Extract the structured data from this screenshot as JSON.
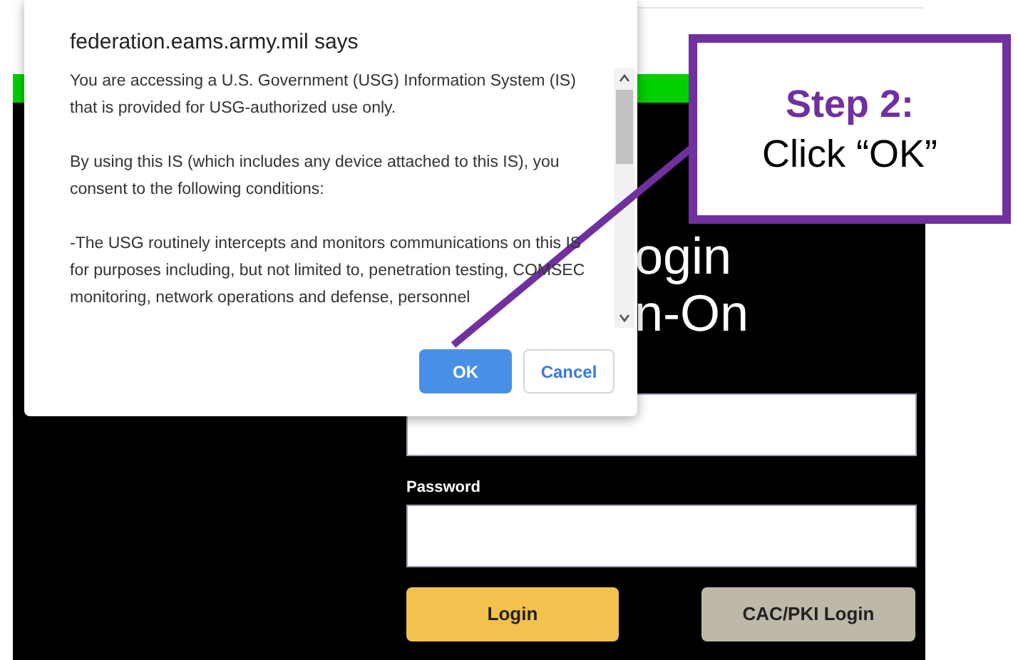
{
  "dialog": {
    "title": "federation.eams.army.mil says",
    "paragraphs": [
      "You are accessing a U.S. Government (USG) Information System (IS) that is provided for USG-authorized use only.",
      "By using this IS (which includes any device attached to this IS), you consent to the following conditions:",
      "-The USG routinely intercepts and monitors communications on this IS for purposes including, but not limited to, penetration testing, COMSEC monitoring, network operations and defense, personnel"
    ],
    "buttons": [
      {
        "label": "OK",
        "kind": "primary"
      },
      {
        "label": "Cancel",
        "kind": "secondary"
      }
    ]
  },
  "page": {
    "heading_lines": [
      "ogin",
      "n-On"
    ],
    "password_label": "Password",
    "buttons": [
      {
        "label": "Login",
        "kind": "primary"
      },
      {
        "label": "CAC/PKI Login",
        "kind": "secondary"
      }
    ]
  },
  "callout": {
    "title": "Step 2:",
    "text": "Click “OK”"
  }
}
